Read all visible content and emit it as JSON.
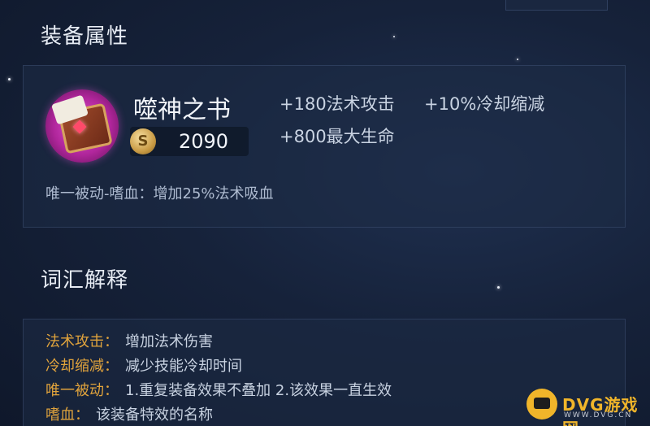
{
  "sections": {
    "attributes_title": "装备属性",
    "glossary_title": "词汇解释"
  },
  "item": {
    "name": "噬神之书",
    "price": "2090",
    "coin_symbol": "S",
    "stats": [
      "+180法术攻击",
      "+10%冷却缩减",
      "+800最大生命"
    ],
    "passive": "唯一被动-嗜血：增加25%法术吸血"
  },
  "glossary": [
    {
      "term": "法术攻击：",
      "def": "增加法术伤害"
    },
    {
      "term": "冷却缩减：",
      "def": "减少技能冷却时间"
    },
    {
      "term": "唯一被动：",
      "def": "1.重复装备效果不叠加 2.该效果一直生效"
    },
    {
      "term": "嗜血：",
      "def": "该装备特效的名称"
    }
  ],
  "watermark": {
    "brand": "DVG游戏网",
    "domain": "WWW.DVG.CN"
  },
  "icons": {
    "item_icon": "book-icon",
    "coin_icon": "gold-coin-icon",
    "logo_icon": "gamepad-logo-icon"
  },
  "colors": {
    "glossary_term": "#e0a33c",
    "item_icon_glow": "#e356d7",
    "watermark": "#f0b52a"
  }
}
